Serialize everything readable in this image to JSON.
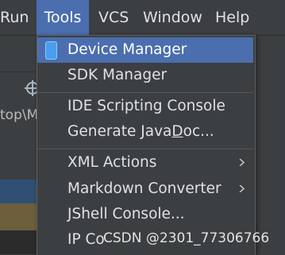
{
  "menubar": {
    "items": [
      {
        "label": "Run",
        "mnemonic": "R"
      },
      {
        "label": "Tools",
        "mnemonic": "T"
      },
      {
        "label": "VCS",
        "mnemonic": "S"
      },
      {
        "label": "Window",
        "mnemonic": "W"
      },
      {
        "label": "Help",
        "mnemonic": "H"
      }
    ]
  },
  "background": {
    "path_fragment": "top\\M"
  },
  "tools_menu": {
    "items": [
      {
        "label": "Device Manager",
        "icon": "device-icon",
        "selected": true
      },
      {
        "label": "SDK Manager"
      },
      {
        "label": "IDE Scripting Console"
      },
      {
        "label_parts": [
          "Generate Java",
          "D",
          "oc..."
        ]
      },
      {
        "label": "XML Actions",
        "submenu": true
      },
      {
        "label": "Markdown Converter",
        "submenu": true
      },
      {
        "label": "JShell Console..."
      },
      {
        "label": "IP Co"
      }
    ]
  },
  "watermark": "CSDN @2301_77306766",
  "colors": {
    "background": "#3c3f41",
    "selection": "#4b6eaf",
    "text": "#dfe1e5",
    "separator": "#555759"
  }
}
